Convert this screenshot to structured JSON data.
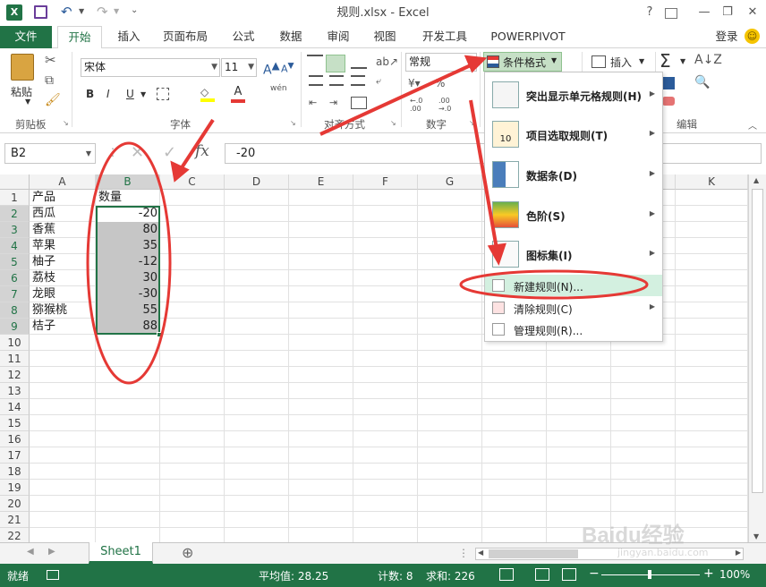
{
  "window": {
    "title": "规则.xlsx - Excel",
    "help": "?",
    "login": "登录"
  },
  "tabs": [
    "文件",
    "开始",
    "插入",
    "页面布局",
    "公式",
    "数据",
    "审阅",
    "视图",
    "开发工具",
    "POWERPIVOT"
  ],
  "ribbon": {
    "clipboard": {
      "paste": "粘贴",
      "group": "剪贴板"
    },
    "font": {
      "name": "宋体",
      "size": "11",
      "group": "字体",
      "bold": "B",
      "italic": "I",
      "underline": "U",
      "wen": "wén",
      "A": "A"
    },
    "align": {
      "group": "对齐方式"
    },
    "number": {
      "format": "常规",
      "group": "数字",
      "pct": "%",
      "dec1": "←.0 .00",
      "dec2": ".00 →.0"
    },
    "cf_button": "条件格式",
    "insert": "插入",
    "editing": {
      "group": "编辑",
      "sigma": "Σ"
    }
  },
  "formula": {
    "namebox": "B2",
    "fx": "fx",
    "value": "-20"
  },
  "columns": [
    "A",
    "B",
    "C",
    "D",
    "E",
    "F",
    "G",
    "H",
    "I",
    "J",
    "K"
  ],
  "rows": [
    "1",
    "2",
    "3",
    "4",
    "5",
    "6",
    "7",
    "8",
    "9",
    "10",
    "11",
    "12",
    "13",
    "14",
    "15",
    "16",
    "17",
    "18",
    "19",
    "20",
    "21",
    "22"
  ],
  "cells": {
    "A": [
      "产品",
      "西瓜",
      "香蕉",
      "苹果",
      "柚子",
      "荔枝",
      "龙眼",
      "猕猴桃",
      "桔子"
    ],
    "B": [
      "数量",
      "-20",
      "80",
      "35",
      "-12",
      "30",
      "-30",
      "55",
      "88"
    ]
  },
  "menu": [
    {
      "label": "突出显示单元格规则(H)",
      "arrow": "▶"
    },
    {
      "label": "项目选取规则(T)",
      "arrow": "▶",
      "icon_text": "10"
    },
    {
      "label": "数据条(D)",
      "arrow": "▶"
    },
    {
      "label": "色阶(S)",
      "arrow": "▶"
    },
    {
      "label": "图标集(I)",
      "arrow": "▶"
    },
    {
      "label": "新建规则(N)..."
    },
    {
      "label": "清除规则(C)",
      "arrow": "▶"
    },
    {
      "label": "管理规则(R)..."
    }
  ],
  "sheet": {
    "tab": "Sheet1",
    "add": "⊕"
  },
  "status": {
    "ready": "就绪",
    "avg": "平均值: 28.25",
    "count": "计数: 8",
    "sum": "求和: 226",
    "zoom": "100%"
  },
  "watermark": {
    "logo": "Baidu经验",
    "url": "jingyan.baidu.com"
  },
  "colors": {
    "excel_green": "#217346",
    "selection": "#c6c6c6",
    "annotation": "#e53935"
  }
}
